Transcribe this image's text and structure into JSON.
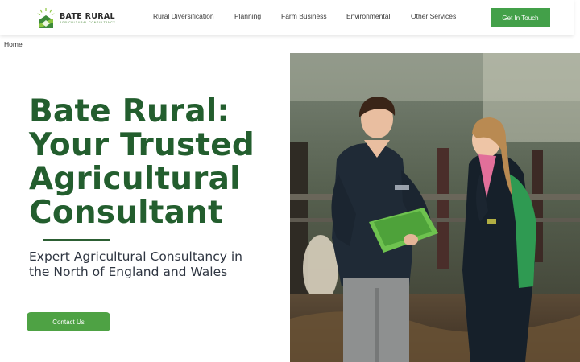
{
  "header": {
    "brand_name": "BATE RURAL",
    "brand_tagline": "AGRICULTURAL CONSULTANCY",
    "nav": [
      {
        "label": "Rural Diversification"
      },
      {
        "label": "Planning"
      },
      {
        "label": "Farm Business"
      },
      {
        "label": "Environmental"
      },
      {
        "label": "Other Services"
      }
    ],
    "cta_label": "Get In Touch"
  },
  "breadcrumb": "Home",
  "hero": {
    "headline": "Bate Rural: Your Trusted Agricultural Consultant",
    "subheadline": "Expert Agricultural Consultancy in the North of England and Wales",
    "button_label": "Contact Us"
  },
  "colors": {
    "brand_green": "#235e2e",
    "button_green": "#43a049",
    "text_dark": "#2f3642"
  },
  "icons": {
    "logo": "bate-rural-logo-icon"
  }
}
